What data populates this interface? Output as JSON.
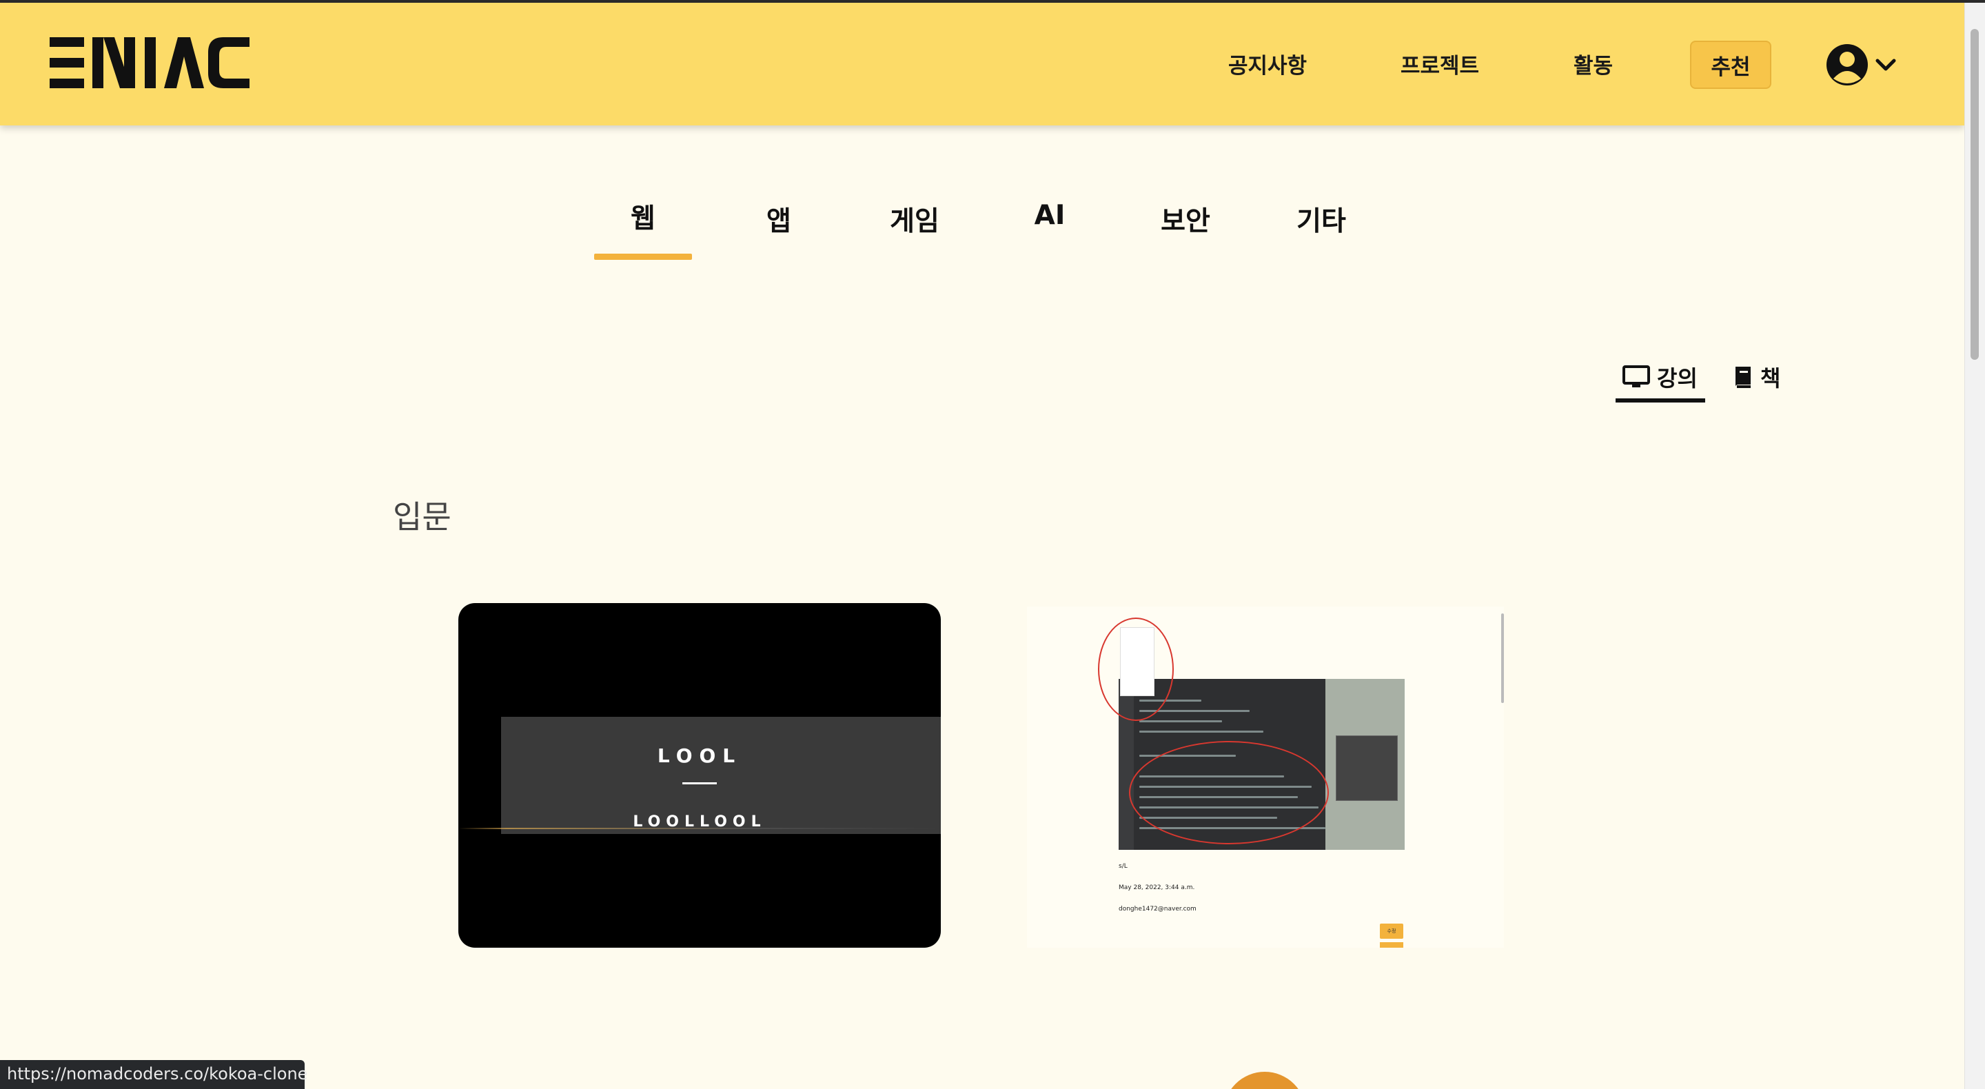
{
  "header": {
    "logo_text": "ENIAC",
    "nav": [
      "공지사항",
      "프로젝트",
      "활동"
    ],
    "recommend_label": "추천",
    "accent_color": "#fcdb68",
    "recommend_color": "#f7c54a"
  },
  "categories": {
    "tabs": [
      "웹",
      "앱",
      "게임",
      "AI",
      "보안",
      "기타"
    ],
    "active": "웹",
    "underline_color": "#f3b23c"
  },
  "types": {
    "lecture_label": "강의",
    "book_label": "책",
    "lecture_icon": "monitor-icon",
    "book_icon": "book-icon",
    "active": "강의"
  },
  "section": {
    "title": "입문"
  },
  "cards": [
    {
      "title_large": "LOOL",
      "title_small": "LOOLLOOL"
    },
    {
      "meta_name": "s/L",
      "meta_date": "May 28, 2022, 3:44 a.m.",
      "meta_email": "donghe1472@naver.com",
      "button_label": "수정"
    }
  ],
  "statusbar": {
    "url": "https://nomadcoders.co/kokoa-clone"
  }
}
